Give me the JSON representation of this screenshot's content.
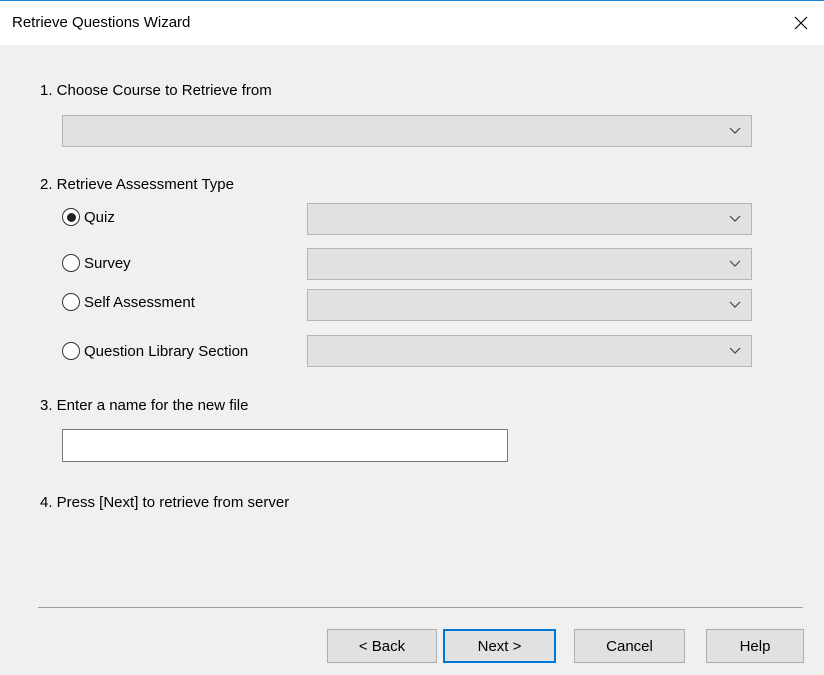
{
  "window": {
    "title": "Retrieve Questions Wizard"
  },
  "steps": {
    "step1": "1.  Choose Course to Retrieve from",
    "step2": "2.  Retrieve Assessment Type",
    "step3": "3.  Enter a name for the new file",
    "step4": "4.  Press [Next] to retrieve from server"
  },
  "course_select": {
    "value": ""
  },
  "assessment_types": [
    {
      "label": "Quiz",
      "selected": true,
      "select_value": ""
    },
    {
      "label": "Survey",
      "selected": false,
      "select_value": ""
    },
    {
      "label": "Self Assessment",
      "selected": false,
      "select_value": ""
    },
    {
      "label": "Question Library Section",
      "selected": false,
      "select_value": ""
    }
  ],
  "file_name": {
    "value": "",
    "placeholder": ""
  },
  "buttons": {
    "back": "< Back",
    "next": "Next >",
    "cancel": "Cancel",
    "help": "Help"
  },
  "icons": {
    "close": "close-icon",
    "dropdown": "chevron-down-icon"
  },
  "colors": {
    "accent": "#0078d7",
    "title_border": "#1883d7"
  }
}
